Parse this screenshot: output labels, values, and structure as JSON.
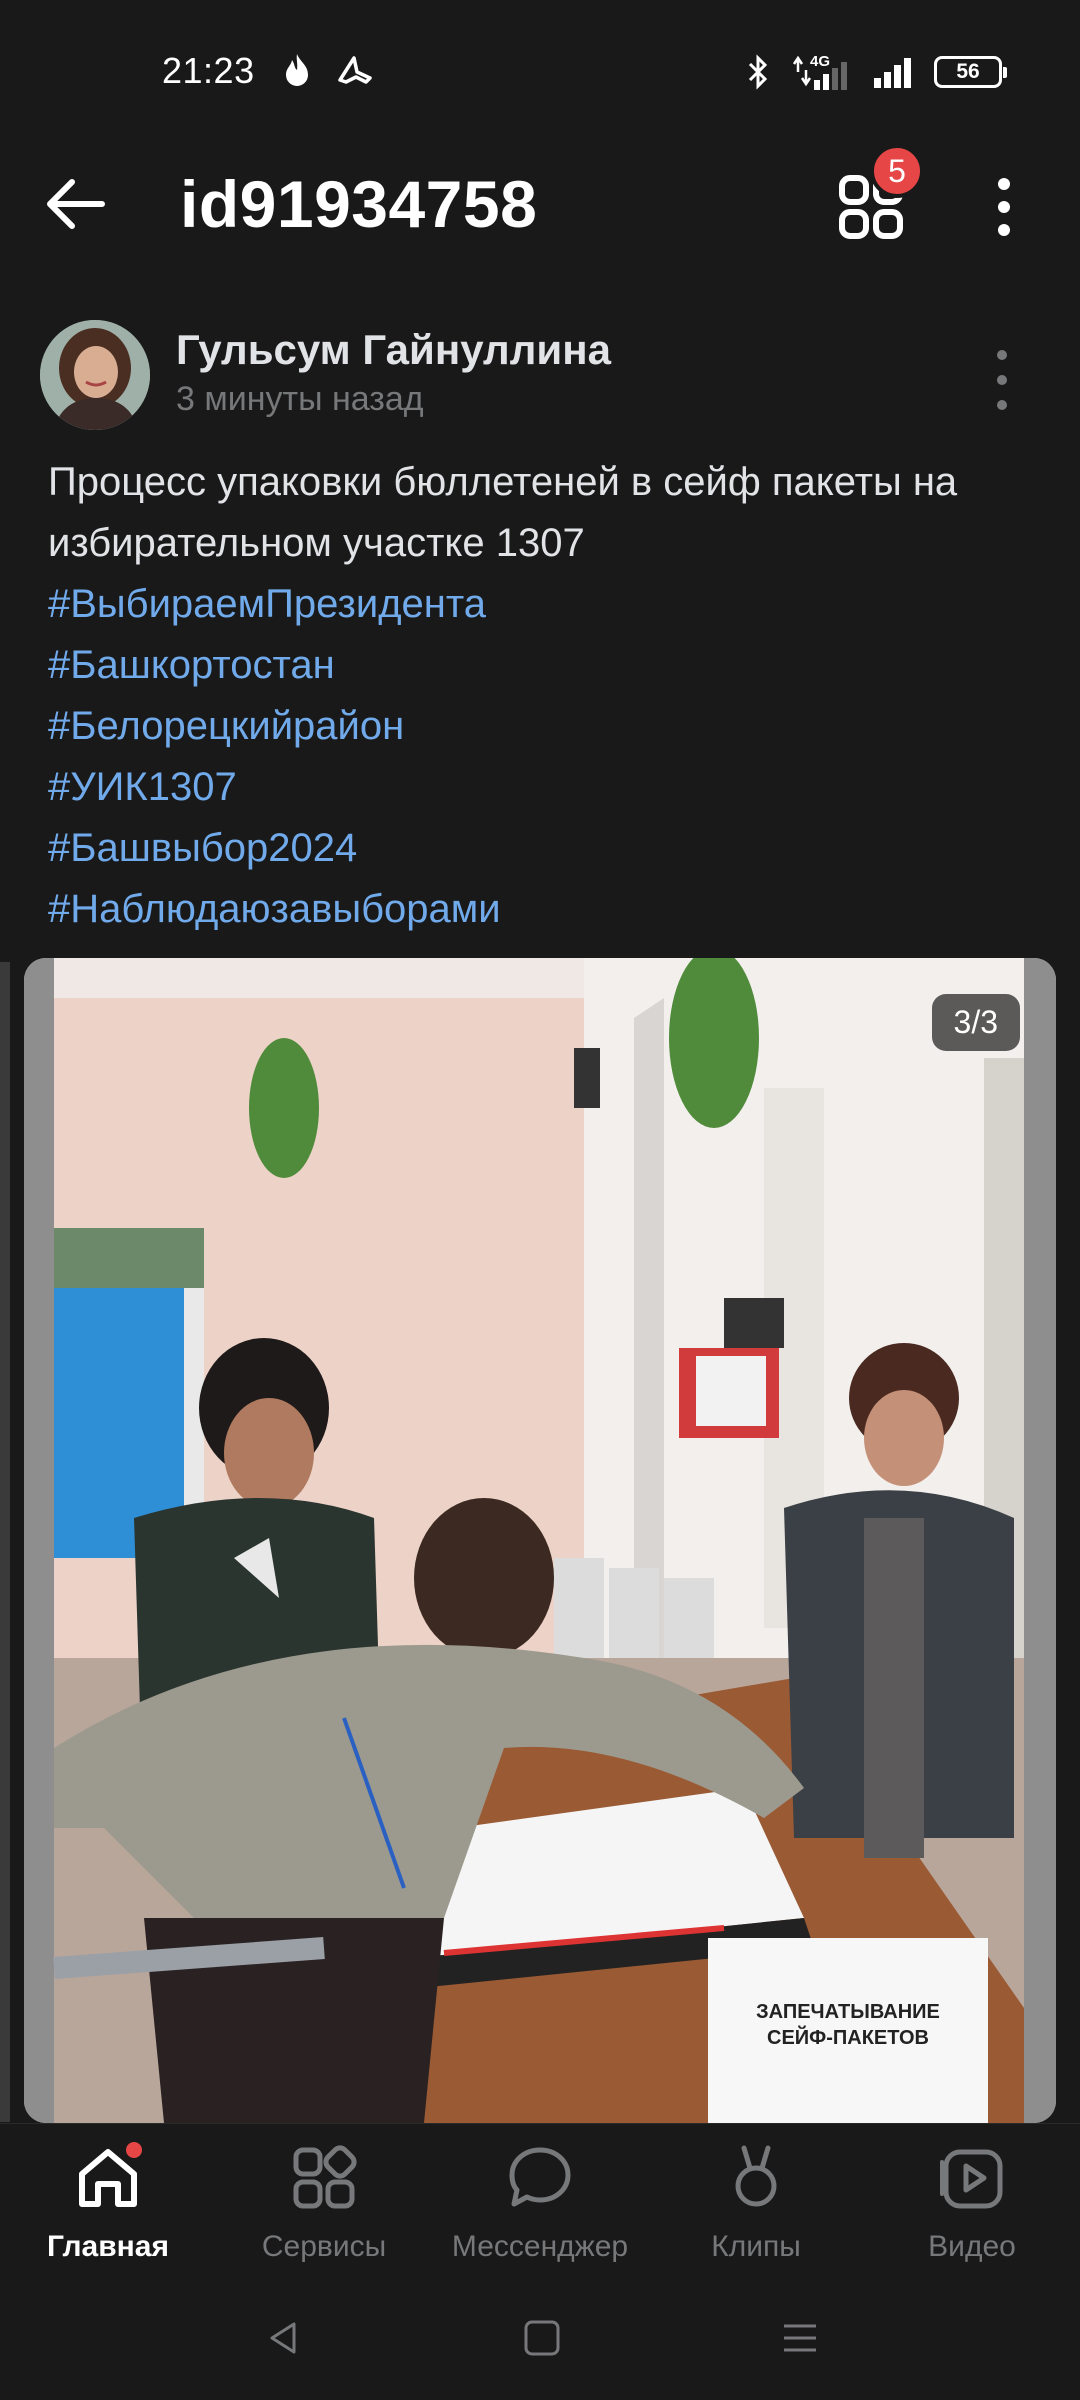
{
  "status": {
    "time": "21:23",
    "network": "4G",
    "battery": "56"
  },
  "header": {
    "title": "id91934758",
    "badge_count": "5"
  },
  "post": {
    "author_name": "Гульсум Гайнуллина",
    "time_ago": "3 минуты назад",
    "text": "Процесс упаковки бюллетеней в сейф пакеты на избирательном участке 1307",
    "hashtags": [
      "#ВыбираемПрезидента",
      "#Башкортостан",
      "#Белорецкийрайон",
      "#УИК1307",
      "#Башвыбор2024",
      "#Наблюдаюзавыборами"
    ],
    "photo_counter": "3/3",
    "photo_sign_text": "ЗАПЕЧАТЫВАНИЕ СЕЙФ-ПАКЕТОВ"
  },
  "nav": {
    "items": [
      {
        "label": "Главная",
        "icon": "home-icon",
        "active": true
      },
      {
        "label": "Сервисы",
        "icon": "services-icon",
        "active": false
      },
      {
        "label": "Мессенджер",
        "icon": "chat-icon",
        "active": false
      },
      {
        "label": "Клипы",
        "icon": "clips-icon",
        "active": false
      },
      {
        "label": "Видео",
        "icon": "video-icon",
        "active": false
      }
    ]
  },
  "colors": {
    "background": "#19191a",
    "hashtag": "#71aaeb",
    "badge": "#e64646",
    "secondary_text": "#76787a"
  }
}
